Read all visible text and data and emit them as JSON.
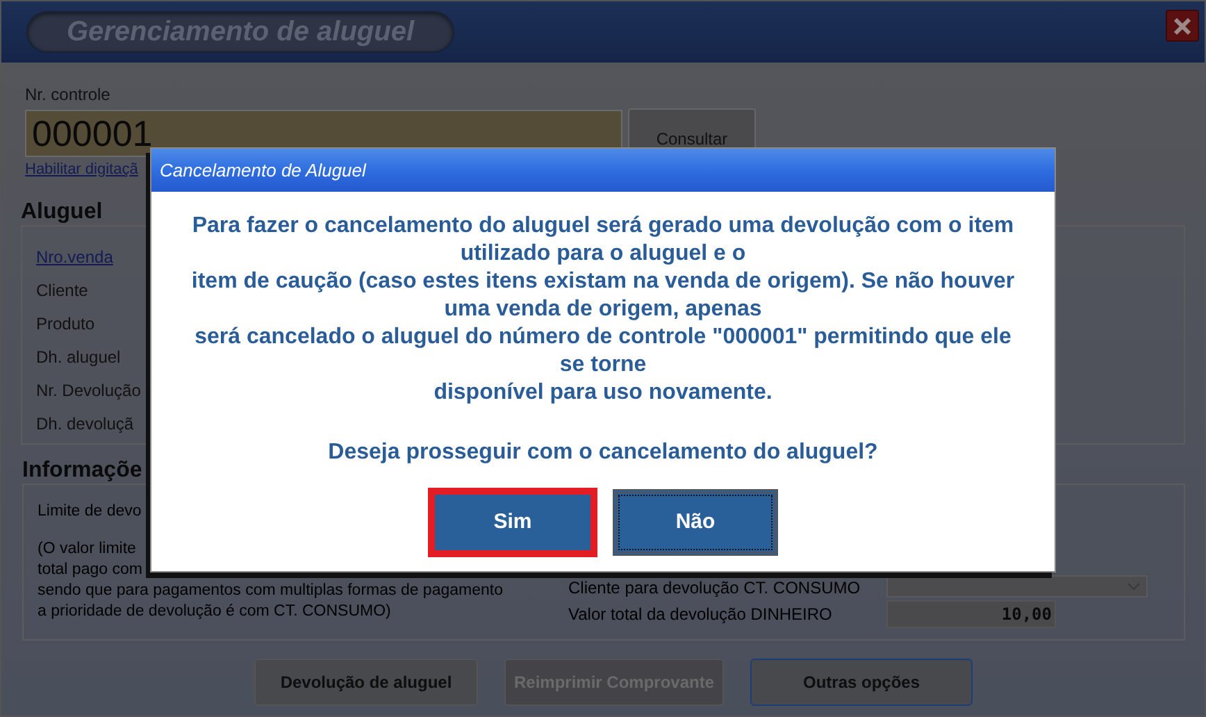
{
  "window": {
    "title": "Gerenciamento de aluguel"
  },
  "control": {
    "label": "Nr. controle",
    "value": "000001",
    "lookup_button": "Consultar",
    "link": "Habilitar digitaçã"
  },
  "rental": {
    "heading": "Aluguel",
    "fields": [
      {
        "label": "Nro.venda",
        "kind": "link"
      },
      {
        "label": "Cliente",
        "kind": "text"
      },
      {
        "label": "Produto",
        "kind": "text"
      },
      {
        "label": "Dh. aluguel",
        "kind": "text"
      },
      {
        "label": "Nr. Devolução",
        "kind": "text"
      },
      {
        "label": "Dh. devoluçã",
        "kind": "text"
      }
    ]
  },
  "info": {
    "heading": "Informaçõe",
    "limit_label": "Limite de devo",
    "note_lines": [
      "(O valor limite",
      "total pago com",
      "sendo que para pagamentos com multiplas formas de pagamento",
      "a prioridade de devolução é com CT. CONSUMO)"
    ],
    "client_label": "Cliente para devolução CT. CONSUMO",
    "total_label": "Valor total da devolução DINHEIRO",
    "total_value": "10,00"
  },
  "buttons": [
    {
      "label": "Devolução de aluguel",
      "disabled": false,
      "focused": false
    },
    {
      "label": "Reimprimir Comprovante",
      "disabled": true,
      "focused": false
    },
    {
      "label": "Outras opções",
      "disabled": false,
      "focused": true
    }
  ],
  "dialog": {
    "title": "Cancelamento de Aluguel",
    "message_lines": [
      "Para fazer o cancelamento do aluguel será gerado uma devolução com o item",
      "utilizado para o aluguel e o",
      "item de caução (caso estes itens existam na venda de origem). Se não houver",
      "uma venda de origem, apenas",
      "será cancelado o aluguel do número de controle \"000001\" permitindo que ele",
      "se torne",
      "disponível para uso novamente."
    ],
    "question": "Deseja prosseguir com o cancelamento do aluguel?",
    "buttons": [
      {
        "label": "Sim",
        "selected": true
      },
      {
        "label": "Não",
        "selected": false
      }
    ]
  }
}
